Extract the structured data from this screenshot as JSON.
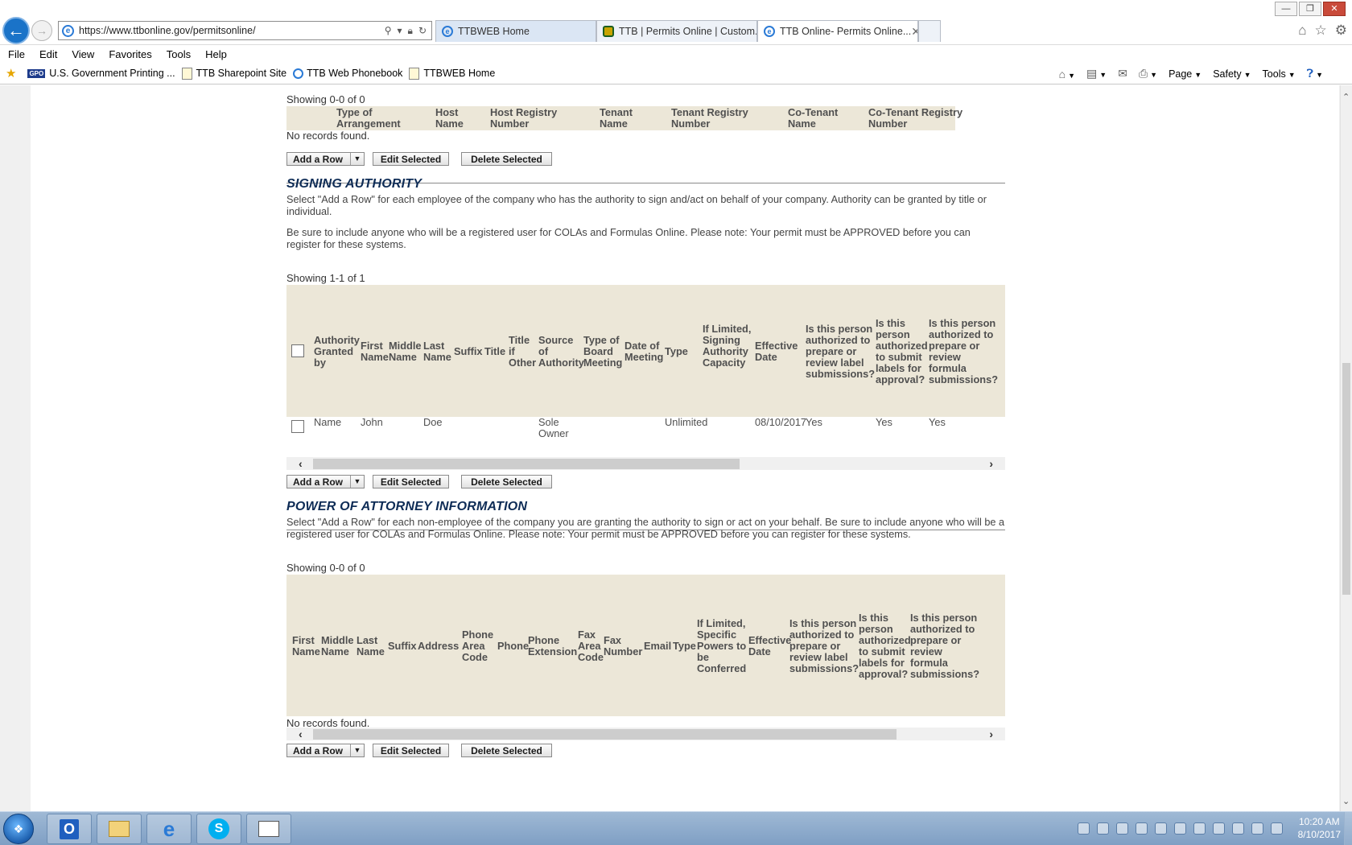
{
  "browser": {
    "url": "https://www.ttbonline.gov/permitsonline/",
    "tabs": [
      {
        "label": "TTBWEB Home"
      },
      {
        "label": "TTB | Permits Online | Custom..."
      },
      {
        "label": "TTB Online- Permits Online..."
      }
    ],
    "menu": [
      "File",
      "Edit",
      "View",
      "Favorites",
      "Tools",
      "Help"
    ],
    "favorites": [
      {
        "label": "U.S. Government Printing ...",
        "badge": "GPO"
      },
      {
        "label": "TTB Sharepoint Site"
      },
      {
        "label": "TTB Web Phonebook"
      },
      {
        "label": "TTBWEB Home"
      }
    ],
    "command_bar": {
      "page": "Page",
      "safety": "Safety",
      "tools": "Tools"
    }
  },
  "buttons": {
    "add_row": "Add a Row",
    "edit_selected": "Edit Selected",
    "delete_selected": "Delete Selected"
  },
  "no_records": "No records found.",
  "alt_table": {
    "showing": "Showing 0-0 of 0",
    "headers": [
      "Type of Arrangement",
      "Host Name",
      "Host Registry Number",
      "Tenant Name",
      "Tenant Registry Number",
      "Co-Tenant Name",
      "Co-Tenant Registry Number"
    ]
  },
  "signing": {
    "title": "SIGNING AUTHORITY",
    "desc1": "Select \"Add a Row\" for each employee of the company who has the authority to sign and/act on behalf of your company. Authority can be granted by title or individual.",
    "desc2": "Be sure to include anyone who will be a registered user for COLAs and Formulas Online. Please note: Your permit must be APPROVED before you can register for these systems.",
    "showing": "Showing 1-1 of 1",
    "headers": [
      "Authority Granted by",
      "First Name",
      "Middle Name",
      "Last Name",
      "Suffix",
      "Title",
      "Title if Other",
      "Source of Authority",
      "Type of Board Meeting",
      "Date of Meeting",
      "Type",
      "If Limited, Signing Authority Capacity",
      "Effective Date",
      "Is this person authorized to prepare or review label submissions?",
      "Is this person authorized to submit labels for approval?",
      "Is this person authorized to prepare or review formula submissions?"
    ],
    "rows": [
      {
        "granted_by": "Name",
        "first": "John",
        "last": "Doe",
        "source": "Sole Owner",
        "type": "Unlimited",
        "effective": "08/10/2017",
        "prep_label": "Yes",
        "submit_label": "Yes",
        "prep_formula": "Yes"
      }
    ]
  },
  "poa": {
    "title": "POWER OF ATTORNEY INFORMATION",
    "desc": "Select \"Add a Row\" for each non-employee of the company you are granting the authority to sign or act on your behalf. Be sure to include anyone who will be a registered user for COLAs and Formulas Online. Please note: Your permit must be APPROVED before you can register for these systems.",
    "showing": "Showing 0-0 of 0",
    "headers": [
      "First Name",
      "Middle Name",
      "Last Name",
      "Suffix",
      "Address",
      "Phone Area Code",
      "Phone",
      "Phone Extension",
      "Fax Area Code",
      "Fax Number",
      "Email",
      "Type",
      "If Limited, Specific Powers to be Conferred",
      "Effective Date",
      "Is this person authorized to prepare or review label submissions?",
      "Is this person authorized to submit labels for approval?",
      "Is this person authorized to prepare or review formula submissions?"
    ]
  },
  "taskbar": {
    "time": "10:20 AM",
    "date": "8/10/2017"
  }
}
